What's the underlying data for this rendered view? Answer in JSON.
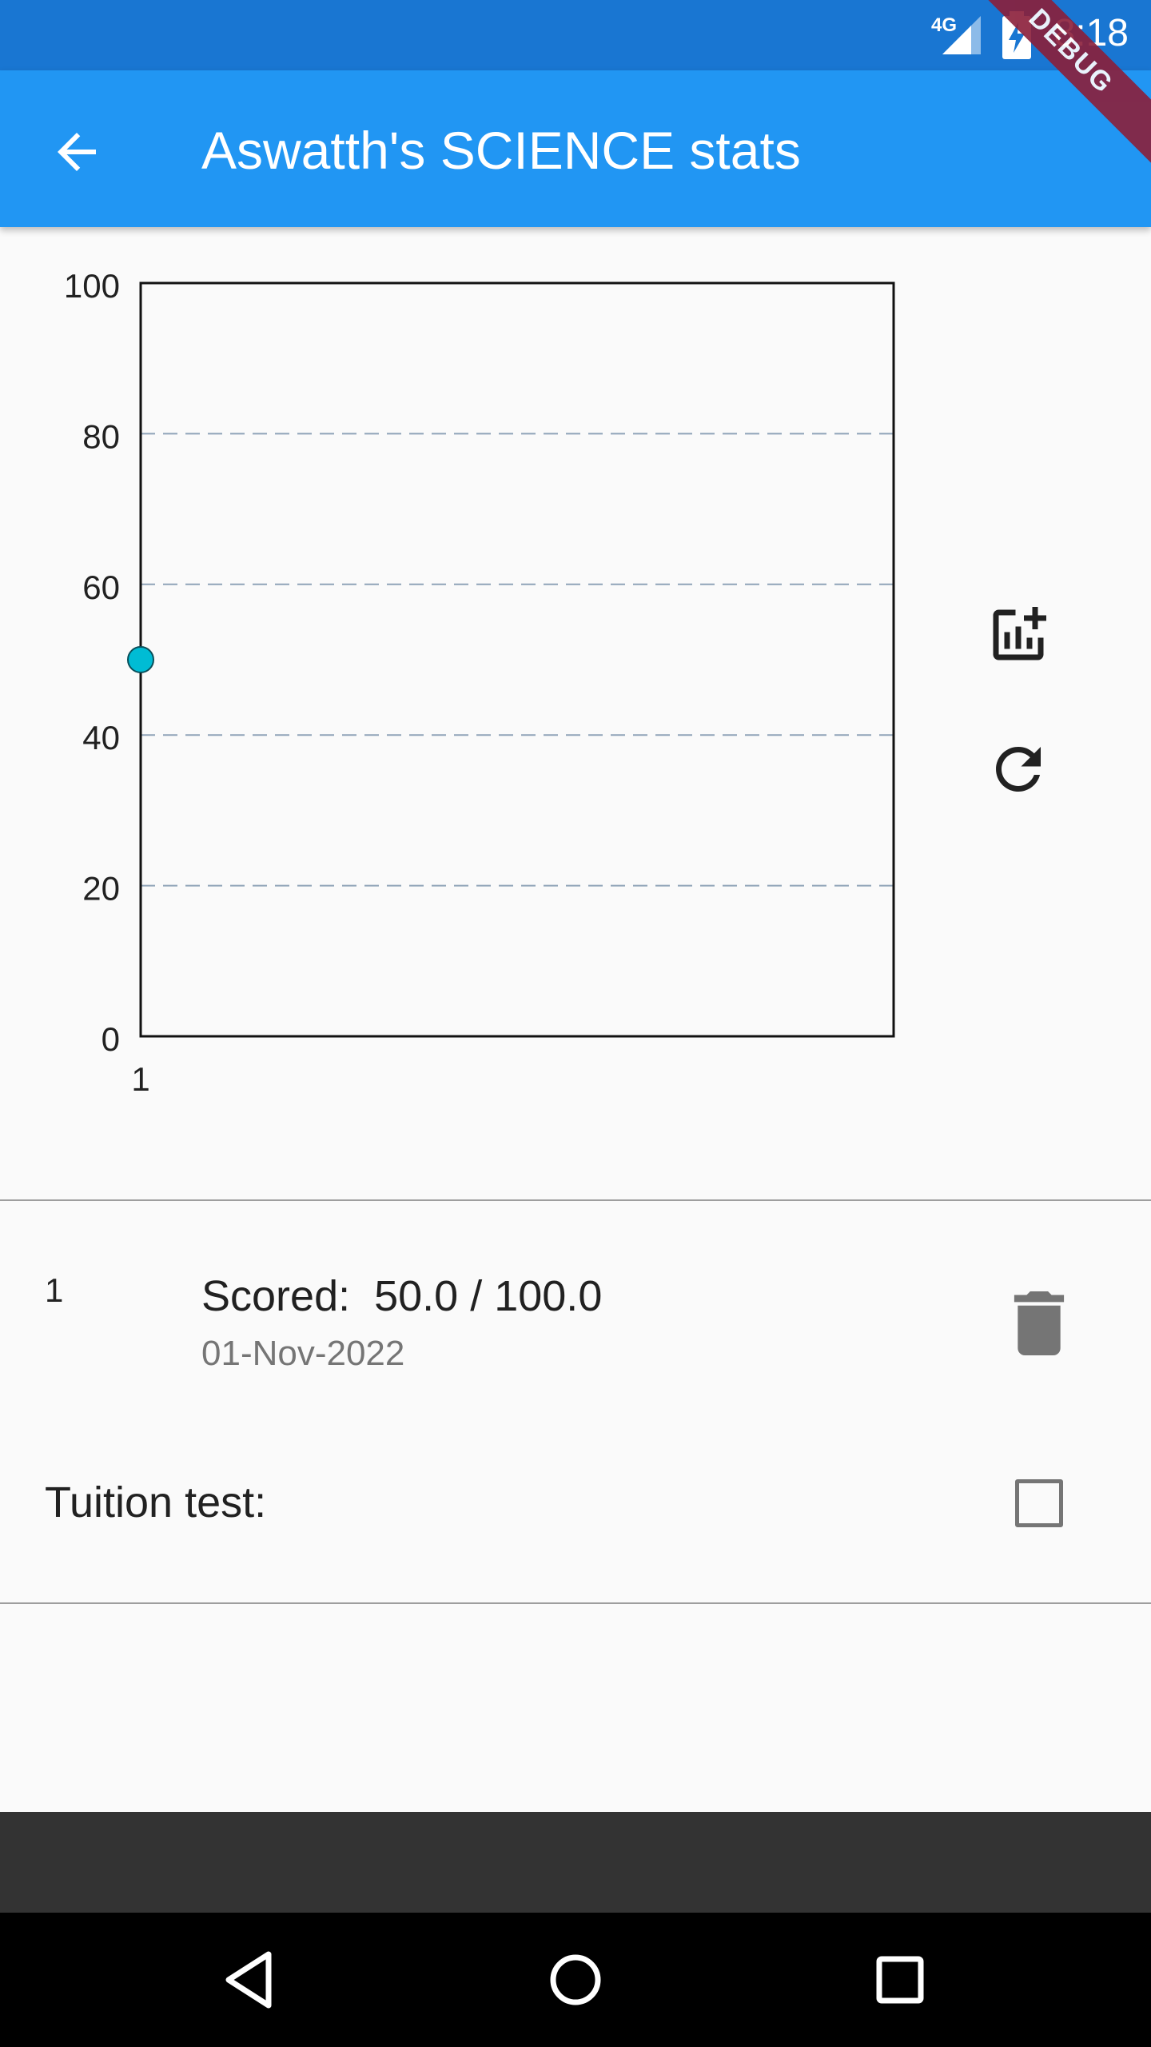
{
  "status_bar": {
    "time": "8:18",
    "network": "4G"
  },
  "debug_banner": "DEBUG",
  "app_bar": {
    "title": "Aswatth's SCIENCE stats",
    "back_icon": "arrow-back-icon"
  },
  "chart_data": {
    "type": "scatter",
    "x": [
      1
    ],
    "y": [
      50
    ],
    "x_tick_labels": [
      "1"
    ],
    "y_ticks": [
      0,
      20,
      40,
      60,
      80,
      100
    ],
    "ylim": [
      0,
      100
    ],
    "grid": "horizontal dashed",
    "point_color": "#00bcd4"
  },
  "side_actions": {
    "add_chart_icon": "add-chart-icon",
    "refresh_icon": "refresh-icon"
  },
  "record": {
    "index": "1",
    "scored_text": "Scored:  50.0 / 100.0",
    "date": "01-Nov-2022",
    "delete_icon": "trash-icon"
  },
  "tuition": {
    "label": "Tuition test:",
    "checked": false
  },
  "colors": {
    "app_bar": "#2196f3",
    "status_bar": "#1976d2",
    "point": "#00bcd4"
  }
}
